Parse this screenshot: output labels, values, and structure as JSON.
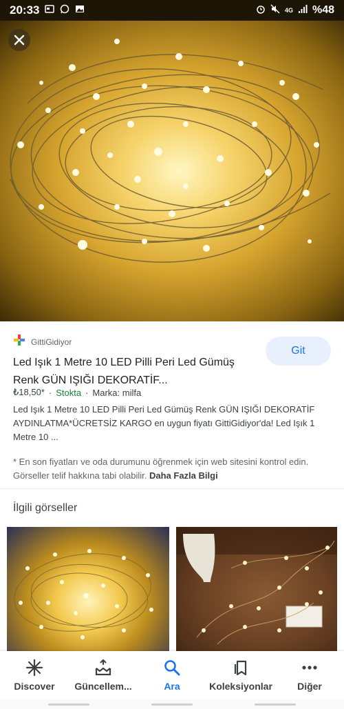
{
  "status_bar": {
    "time": "20:33",
    "network": "4G",
    "battery": "%48"
  },
  "source": {
    "name": "GittiGidiyor"
  },
  "product": {
    "title": "Led Işık 1 Metre 10 LED Pilli Peri Led Gümüş Renk GÜN IŞIĞI DEKORATİF...",
    "price": "₺18,50*",
    "sep1": "·",
    "stock": "Stokta",
    "sep2": "·",
    "brand": "Marka: milfa",
    "description": "Led Işık 1 Metre 10 LED Pilli Peri Led Gümüş Renk GÜN IŞIĞI DEKORATİF AYDINLATMA*ÜCRETSİZ KARGO en uygun fiyatı GittiGidiyor'da! Led Işık 1 Metre 10 ...",
    "go_label": "Git"
  },
  "disclaimer": {
    "text": "* En son fiyatları ve oda durumunu öğrenmek için web sitesini kontrol edin. Görseller telif hakkına tabi olabilir. ",
    "more_link": "Daha Fazla Bilgi"
  },
  "related": {
    "heading": "İlgili görseller"
  },
  "bottom_nav": {
    "items": [
      {
        "label": "Discover",
        "icon": "asterisk-icon"
      },
      {
        "label": "Güncellem...",
        "icon": "updates-icon"
      },
      {
        "label": "Ara",
        "icon": "search-icon"
      },
      {
        "label": "Koleksiyonlar",
        "icon": "bookmark-icon"
      },
      {
        "label": "Diğer",
        "icon": "more-icon"
      }
    ],
    "active_index": 2
  },
  "colors": {
    "accent": "#1a73e8",
    "stock_green": "#188038",
    "status_bar_bg": "#1d1606"
  }
}
